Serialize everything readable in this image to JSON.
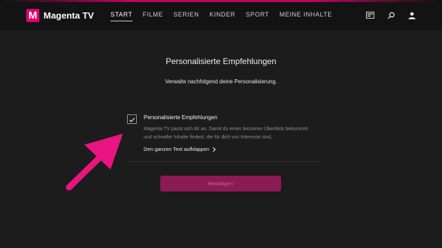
{
  "header": {
    "logo_letter": "M",
    "brand": "Magenta TV",
    "nav": [
      "START",
      "FILME",
      "SERIEN",
      "KINDER",
      "SPORT",
      "MEINE INHALTE"
    ],
    "active_nav": "START",
    "icons": [
      "tv-guide-icon",
      "search-icon",
      "user-icon"
    ]
  },
  "main": {
    "title": "Personalisierte Empfehlungen",
    "subtitle": "Verwalte nachfolgend deine Personalisierung.",
    "option": {
      "checked": true,
      "label": "Personalisierte Empfehlungen",
      "description": "Magenta TV passt sich dir an. Damit du einen besseren Überblick bekommst und schneller Inhalte findest, die für dich von Interesse sind,",
      "expand_link": "Den ganzen Text aufklappen"
    },
    "confirm_button": "Bestätigen"
  },
  "colors": {
    "accent": "#e20074",
    "background": "#1c1c1c",
    "annotation_arrow": "#e8147f"
  }
}
